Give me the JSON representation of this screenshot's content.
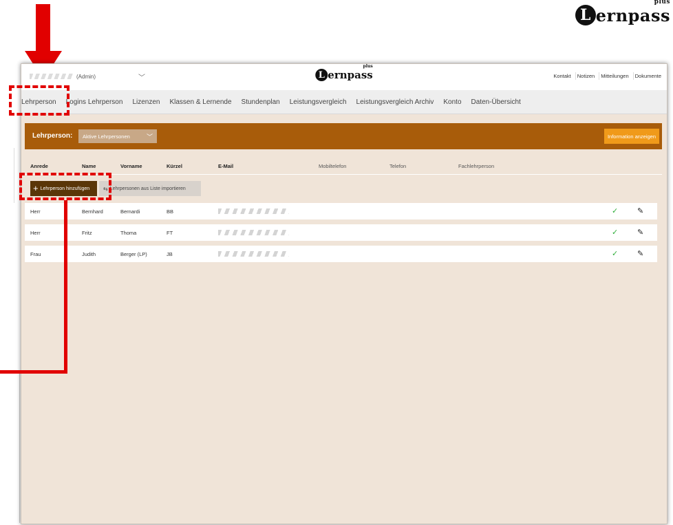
{
  "brand": {
    "logo_word": "ernpass",
    "logo_letter": "L",
    "logo_plus": "plus"
  },
  "header": {
    "user_label": "(Admin)",
    "center_logo_word": "ernpass",
    "center_logo_letter": "L",
    "center_logo_plus": "plus",
    "links": [
      "Kontakt",
      "Notizen",
      "Mitteilungen",
      "Dokumente"
    ]
  },
  "nav": {
    "items": [
      "Lehrperson",
      "Logins Lehrperson",
      "Lizenzen",
      "Klassen & Lernende",
      "Stundenplan",
      "Leistungsvergleich",
      "Leistungsvergleich Archiv",
      "Konto",
      "Daten-Übersicht"
    ]
  },
  "filter": {
    "label": "Lehrperson:",
    "selected": "Aktive Lehrpersonen",
    "info_button": "Information anzeigen"
  },
  "table": {
    "columns": [
      "Anrede",
      "Name",
      "Vorname",
      "Kürzel",
      "E-Mail",
      "Mobiltelefon",
      "Telefon",
      "Fachlehrperson"
    ],
    "add_button": "Lehrperson hinzufügen",
    "import_button": "Lehrpersonen aus Liste importieren",
    "rows": [
      {
        "anrede": "Herr",
        "name": "Bernhard",
        "vorname": "Bernardi",
        "kuerzel": "BB"
      },
      {
        "anrede": "Herr",
        "name": "Fritz",
        "vorname": "Thoma",
        "kuerzel": "FT"
      },
      {
        "anrede": "Frau",
        "name": "Judith",
        "vorname": "Berger (LP)",
        "kuerzel": "JB"
      }
    ]
  },
  "icons": {
    "check": "check-icon",
    "edit": "pencil-icon",
    "chevron": "chevron-down-icon",
    "plus": "plus-icon",
    "import": "import-icon"
  },
  "colors": {
    "accent": "#a85c0a",
    "add_button": "#5a3608",
    "info_button": "#f09a1a",
    "annotation": "#e10000",
    "background": "#f0e4d8"
  }
}
